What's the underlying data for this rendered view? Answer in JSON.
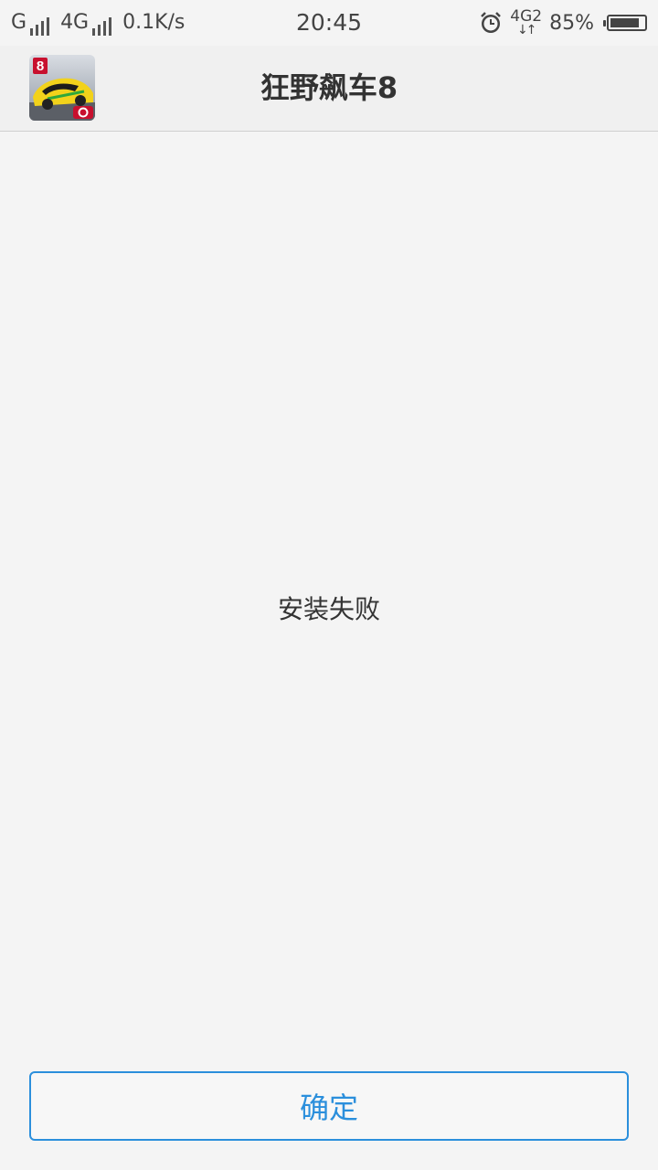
{
  "status_bar": {
    "sim1_type": "G",
    "sim2_type": "4G",
    "net_speed": "0.1K/s",
    "time": "20:45",
    "alarm_icon": "alarm-clock-icon",
    "net_badge": "4G2",
    "battery_percent_text": "85%",
    "battery_level": 0.85
  },
  "header": {
    "app_icon": "asphalt-8-app-icon",
    "title": "狂野飙车8"
  },
  "main": {
    "message": "安装失败"
  },
  "footer": {
    "confirm_label": "确定"
  },
  "colors": {
    "accent": "#2b8fdc",
    "background": "#f4f4f4"
  }
}
